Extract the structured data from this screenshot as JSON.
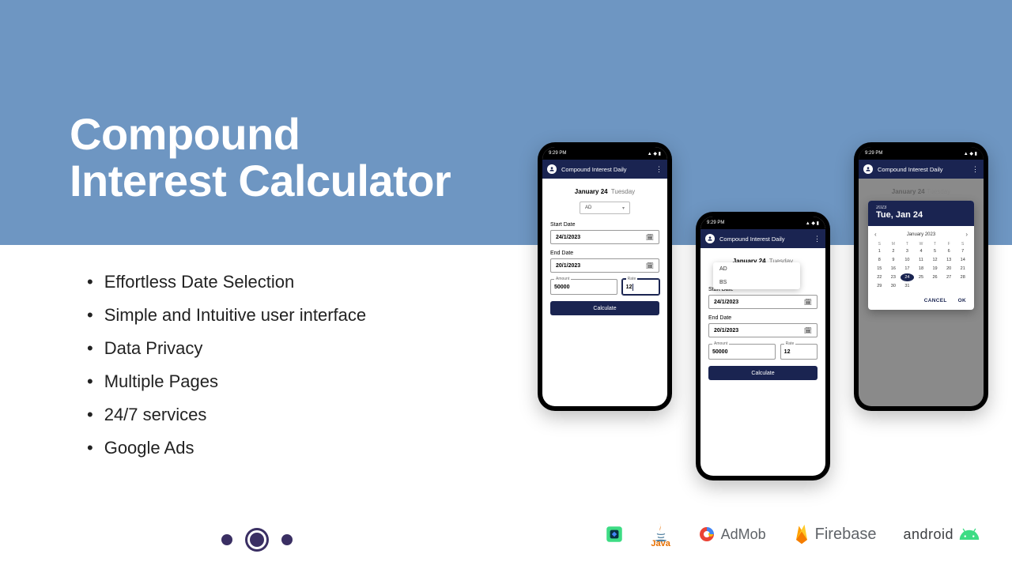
{
  "hero": {
    "title_line1": "Compound",
    "title_line2": "Interest Calculator"
  },
  "features": [
    "Effortless Date Selection",
    "Simple and Intuitive user interface",
    "Data Privacy",
    "Multiple Pages",
    "24/7 services",
    "Google Ads"
  ],
  "logos": {
    "admob": "AdMob",
    "firebase": "Firebase",
    "android": "android",
    "java_sub": "Java"
  },
  "phone_common": {
    "status_time": "9:29 PM",
    "app_title": "Compound Interest Daily",
    "date_header_date": "January 24",
    "date_header_day": "Tuesday",
    "dropdown_value": "AD",
    "start_label": "Start Date",
    "start_value": "24/1/2023",
    "end_label": "End Date",
    "end_value": "20/1/2023",
    "amount_label": "Amount",
    "amount_value": "50000",
    "rate_label": "Rate",
    "rate_value_p1": "12",
    "rate_value_p2": "12",
    "calc_label": "Calculate",
    "dd_opt1": "AD",
    "dd_opt2": "BS"
  },
  "picker": {
    "year": "2023",
    "header_date": "Tue, Jan 24",
    "month": "January 2023",
    "dows": [
      "S",
      "M",
      "T",
      "W",
      "T",
      "F",
      "S"
    ],
    "days": [
      1,
      2,
      3,
      4,
      5,
      6,
      7,
      8,
      9,
      10,
      11,
      12,
      13,
      14,
      15,
      16,
      17,
      18,
      19,
      20,
      21,
      22,
      23,
      24,
      25,
      26,
      27,
      28,
      29,
      30,
      31
    ],
    "lead_blanks": 0,
    "selected": 24,
    "cancel": "CANCEL",
    "ok": "OK"
  }
}
